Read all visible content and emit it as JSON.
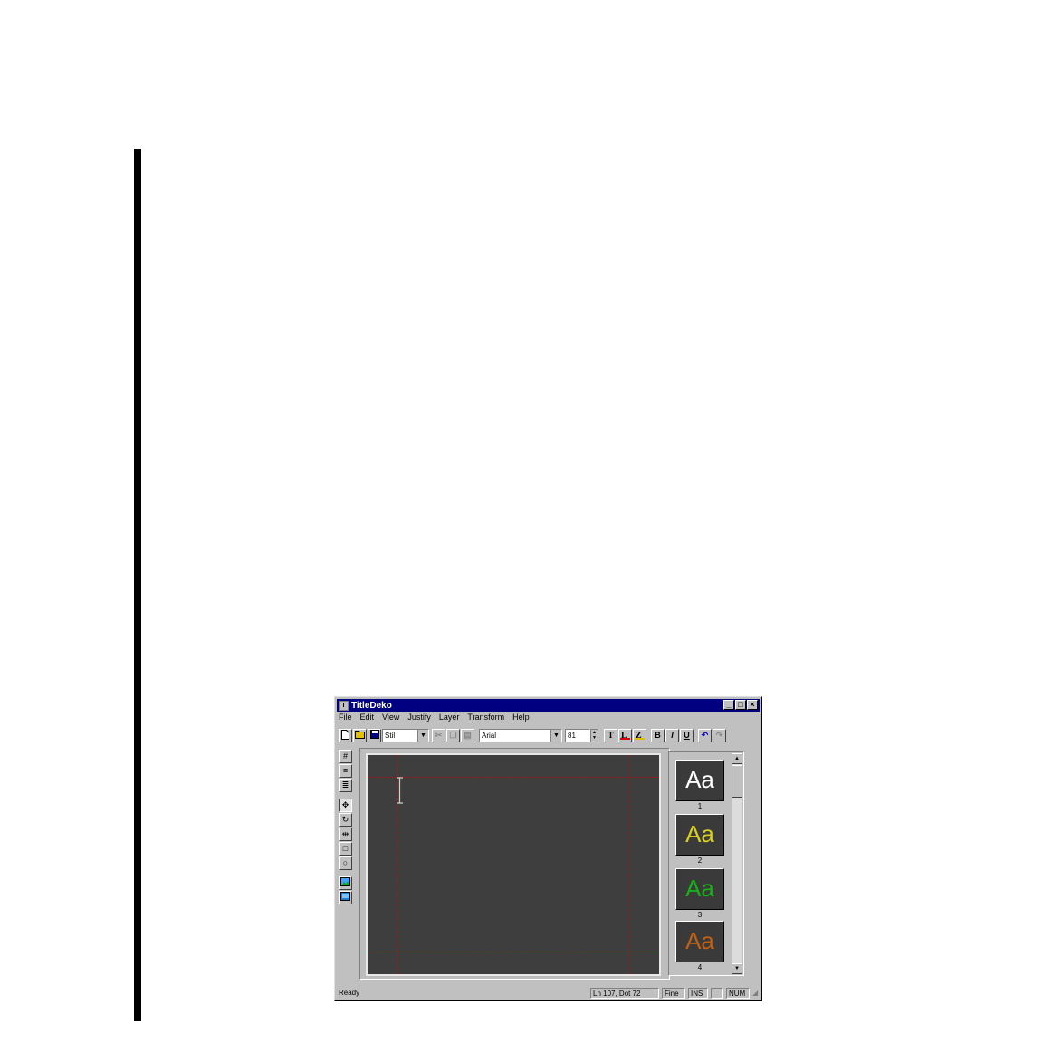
{
  "window": {
    "title": "TitleDeko",
    "icon": "app-icon"
  },
  "menubar": {
    "items": [
      "File",
      "Edit",
      "View",
      "Justify",
      "Layer",
      "Transform",
      "Help"
    ]
  },
  "toolbar": {
    "style_combo": "Stil",
    "font_combo": "Arial",
    "size_combo": "81",
    "text_button": "T",
    "bold_button": "B",
    "italic_button": "I",
    "underline_button": "U"
  },
  "styles_panel": {
    "samples": [
      {
        "label": "Aa",
        "number": "1",
        "color": "#ffffff"
      },
      {
        "label": "Aa",
        "number": "2",
        "color": "#d8d020"
      },
      {
        "label": "Aa",
        "number": "3",
        "color": "#18b018"
      },
      {
        "label": "Aa",
        "number": "4",
        "color": "#c06010"
      }
    ]
  },
  "statusbar": {
    "message": "Ready",
    "position": "Ln 107, Dot 72",
    "quality": "Fine",
    "insert": "INS",
    "num": "NUM"
  }
}
